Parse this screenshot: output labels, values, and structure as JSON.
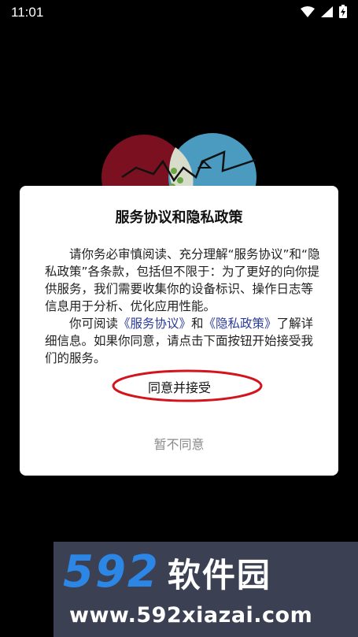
{
  "status_bar": {
    "time": "11:01"
  },
  "dialog": {
    "title": "服务协议和隐私政策",
    "para1": "请你务必审慎阅读、充分理解“服务协议”和“隐私政策”各条款，包括但不限于：为了更好的向你提供服务，我们需要收集你的设备标识、操作日志等信息用于分析、优化应用性能。",
    "para2_prefix": "你可阅读",
    "service_link": "《服务协议》",
    "para2_and": "和",
    "privacy_link": "《隐私政策》",
    "para2_suffix": "了解详细信息。如果你同意，请点击下面按钮开始接受我们的服务。",
    "accept_label": "同意并接受",
    "decline_label": "暂不同意"
  },
  "watermark": {
    "number": "592",
    "name": "软件园",
    "url": "www.592xiazai.com"
  },
  "colors": {
    "link": "#2a3b9a",
    "annotation_circle": "#d4141c",
    "watermark_bg": "#3b4053",
    "watermark_blue": "#2b86e6"
  }
}
